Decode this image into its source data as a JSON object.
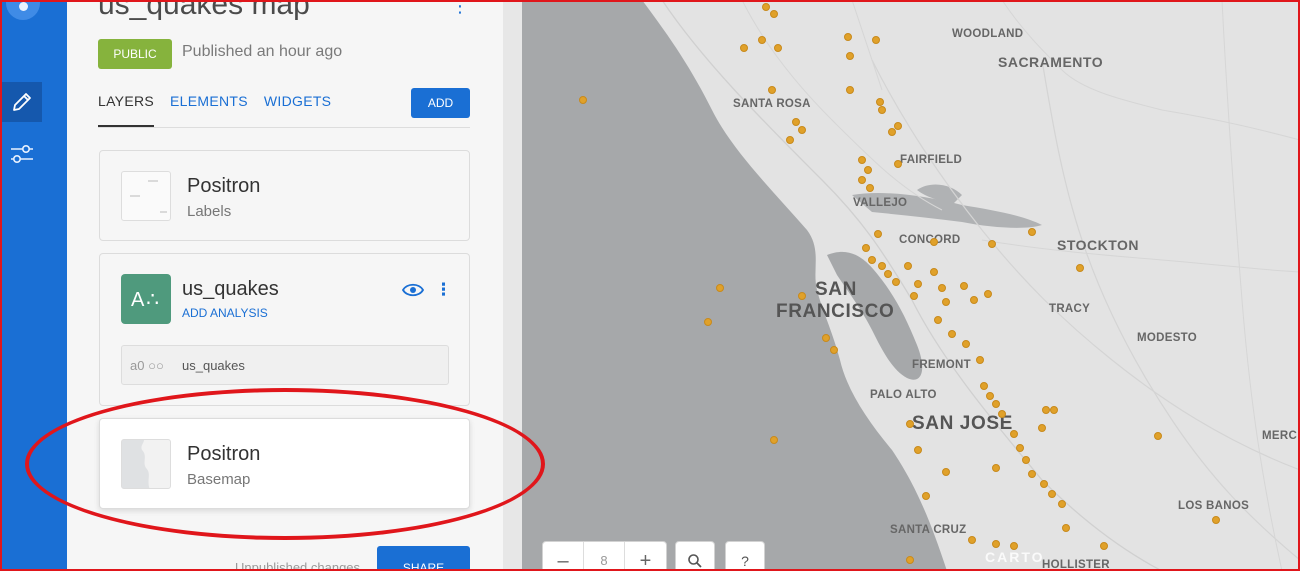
{
  "rail": {
    "items": [
      {
        "icon": "pencil-icon",
        "active": true
      },
      {
        "icon": "sliders-icon",
        "active": false
      }
    ]
  },
  "header": {
    "map_title": "us_quakes map",
    "privacy_badge": "PUBLIC",
    "published_text": "Published an hour ago"
  },
  "tabs": [
    {
      "label": "LAYERS",
      "active": true
    },
    {
      "label": "ELEMENTS",
      "active": false
    },
    {
      "label": "WIDGETS",
      "active": false
    }
  ],
  "add_button": "ADD",
  "layers": {
    "labels": {
      "title": "Positron",
      "subtitle": "Labels"
    },
    "data_layer": {
      "icon_text": "A∴",
      "name": "us_quakes",
      "action": "ADD ANALYSIS",
      "node_id": "a0",
      "source_name": "us_quakes"
    },
    "basemap": {
      "title": "Positron",
      "subtitle": "Basemap"
    }
  },
  "footer": {
    "status": "Unpublished changes",
    "share_button": "SHARE"
  },
  "map": {
    "cities_small": [
      "WOODLAND",
      "SANTA ROSA",
      "FAIRFIELD",
      "VALLEJO",
      "CONCORD",
      "TRACY",
      "MODESTO",
      "FREMONT",
      "PALO ALTO",
      "SANTA CRUZ",
      "LOS BANOS",
      "MERC",
      "HOLLISTER"
    ],
    "cities_mid": [
      "SACRAMENTO",
      "STOCKTON"
    ],
    "cities_big": [
      "SAN",
      "FRANCISCO",
      "SAN JOSE"
    ],
    "attribution": "CARTO",
    "zoom_level": "8",
    "zoom_out": "–",
    "zoom_in": "+",
    "search_icon": "search-icon",
    "help_label": "?"
  },
  "colors": {
    "accent": "#1a6fd4",
    "public_badge": "#86b33d",
    "quake": "#e0a12a",
    "layer_icon": "#4f9a7d",
    "annotation": "#e0161b"
  }
}
